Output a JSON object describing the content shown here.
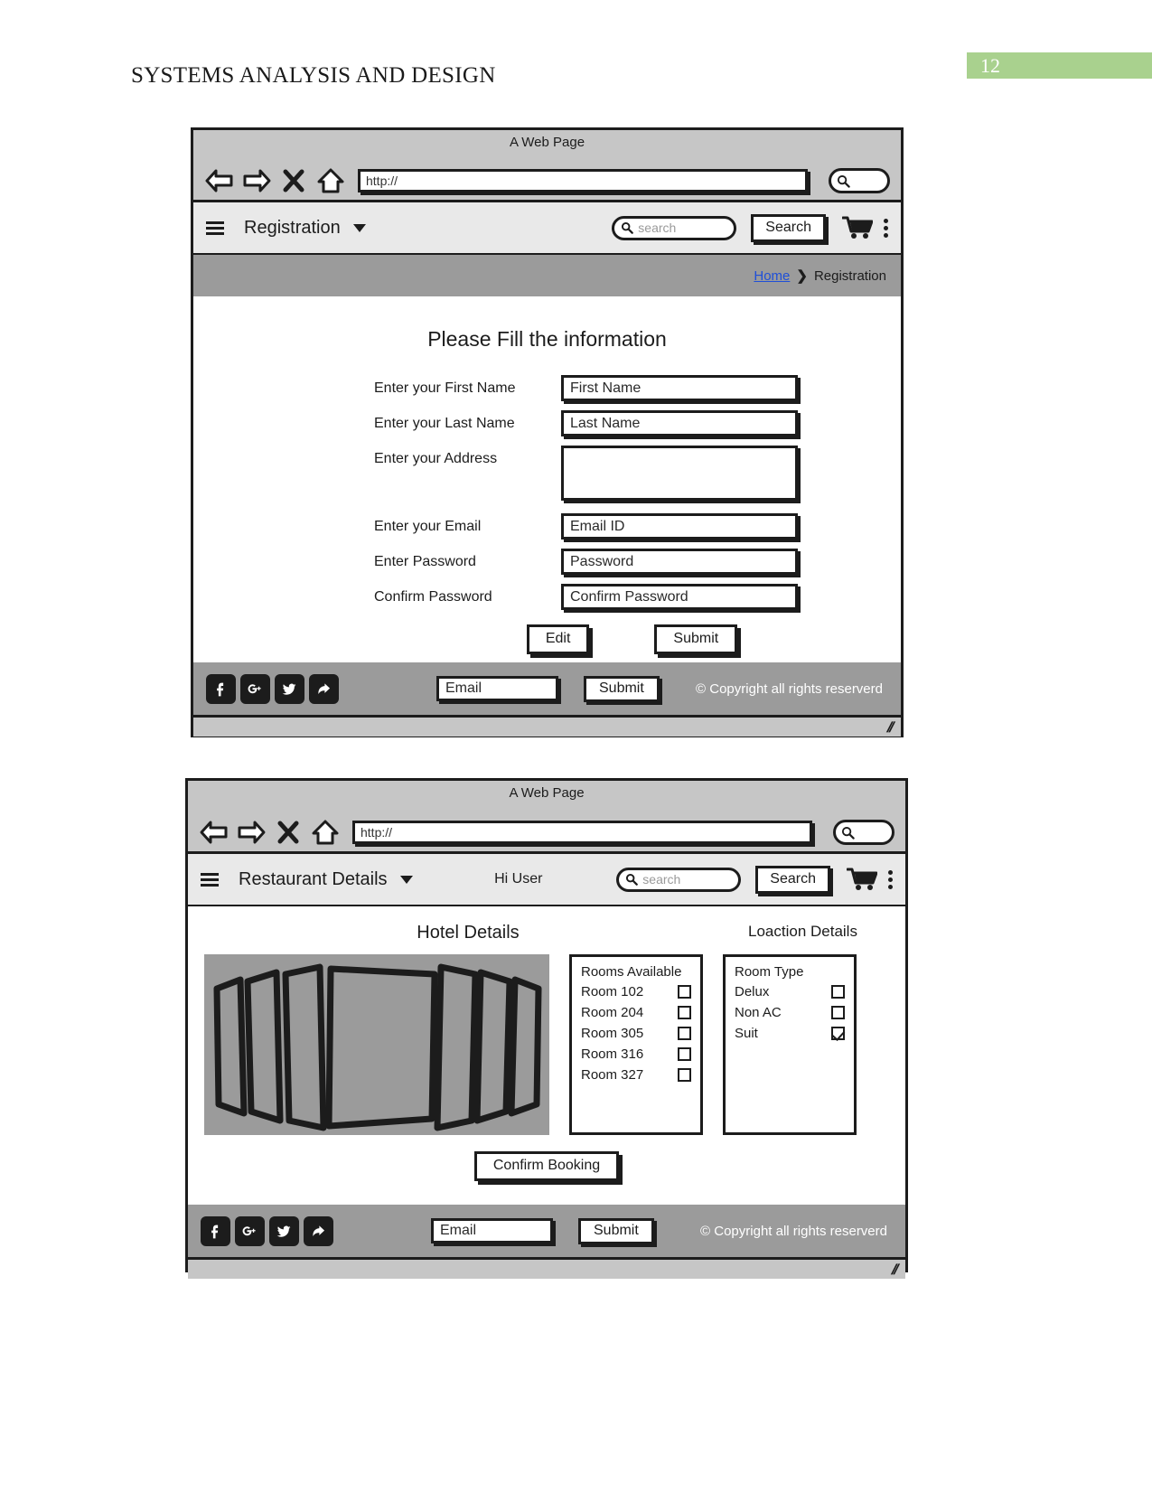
{
  "document": {
    "title": "SYSTEMS ANALYSIS AND DESIGN",
    "page_number": "12",
    "badge_color": "#a9d18e"
  },
  "browser_chrome": {
    "window_title": "A Web Page",
    "url_value": "http://",
    "icons": [
      "back-arrow-icon",
      "forward-arrow-icon",
      "close-icon",
      "home-icon",
      "search-icon"
    ]
  },
  "wireframe1": {
    "navbar": {
      "menu_icon": "hamburger-icon",
      "brand": "Registration",
      "search_placeholder": "search",
      "search_button": "Search",
      "cart_icon": "shopping-cart-icon",
      "overflow_icon": "kebab-menu-icon"
    },
    "breadcrumb": {
      "home": "Home",
      "separator": "❯",
      "current": "Registration"
    },
    "form": {
      "heading": "Please Fill the information",
      "fields": [
        {
          "label": "Enter your First Name",
          "value": "First Name",
          "type": "text"
        },
        {
          "label": "Enter your Last Name",
          "value": "Last Name",
          "type": "text"
        },
        {
          "label": "Enter your Address",
          "value": "",
          "type": "textarea"
        },
        {
          "label": "Enter your Email",
          "value": "Email ID",
          "type": "text"
        },
        {
          "label": "Enter Password",
          "value": "Password",
          "type": "text"
        },
        {
          "label": "Confirm Password",
          "value": "Confirm Password",
          "type": "text"
        }
      ],
      "edit_button": "Edit",
      "submit_button": "Submit"
    }
  },
  "wireframe2": {
    "navbar": {
      "menu_icon": "hamburger-icon",
      "brand": "Restaurant Details",
      "greeting": "Hi User",
      "search_placeholder": "search",
      "search_button": "Search",
      "cart_icon": "shopping-cart-icon",
      "overflow_icon": "kebab-menu-icon"
    },
    "hotel": {
      "title_left": "Hotel Details",
      "title_right": "Loaction Details",
      "image_placeholder": "hotel-image-placeholder",
      "rooms_panel": {
        "header": "Rooms Available",
        "rows": [
          {
            "label": "Room 102",
            "checked": false
          },
          {
            "label": "Room 204",
            "checked": false
          },
          {
            "label": "Room 305",
            "checked": false
          },
          {
            "label": "Room 316",
            "checked": false
          },
          {
            "label": "Room 327",
            "checked": false
          }
        ]
      },
      "types_panel": {
        "header": "Room Type",
        "rows": [
          {
            "label": "Delux",
            "checked": false
          },
          {
            "label": "Non AC",
            "checked": false
          },
          {
            "label": "Suit",
            "checked": true
          }
        ]
      },
      "confirm_button": "Confirm Booking"
    }
  },
  "footer": {
    "social_icons": [
      "facebook-icon",
      "google-plus-icon",
      "twitter-icon",
      "share-icon"
    ],
    "email_value": "Email",
    "submit_button": "Submit",
    "copyright": "© Copyright all rights reserverd"
  }
}
